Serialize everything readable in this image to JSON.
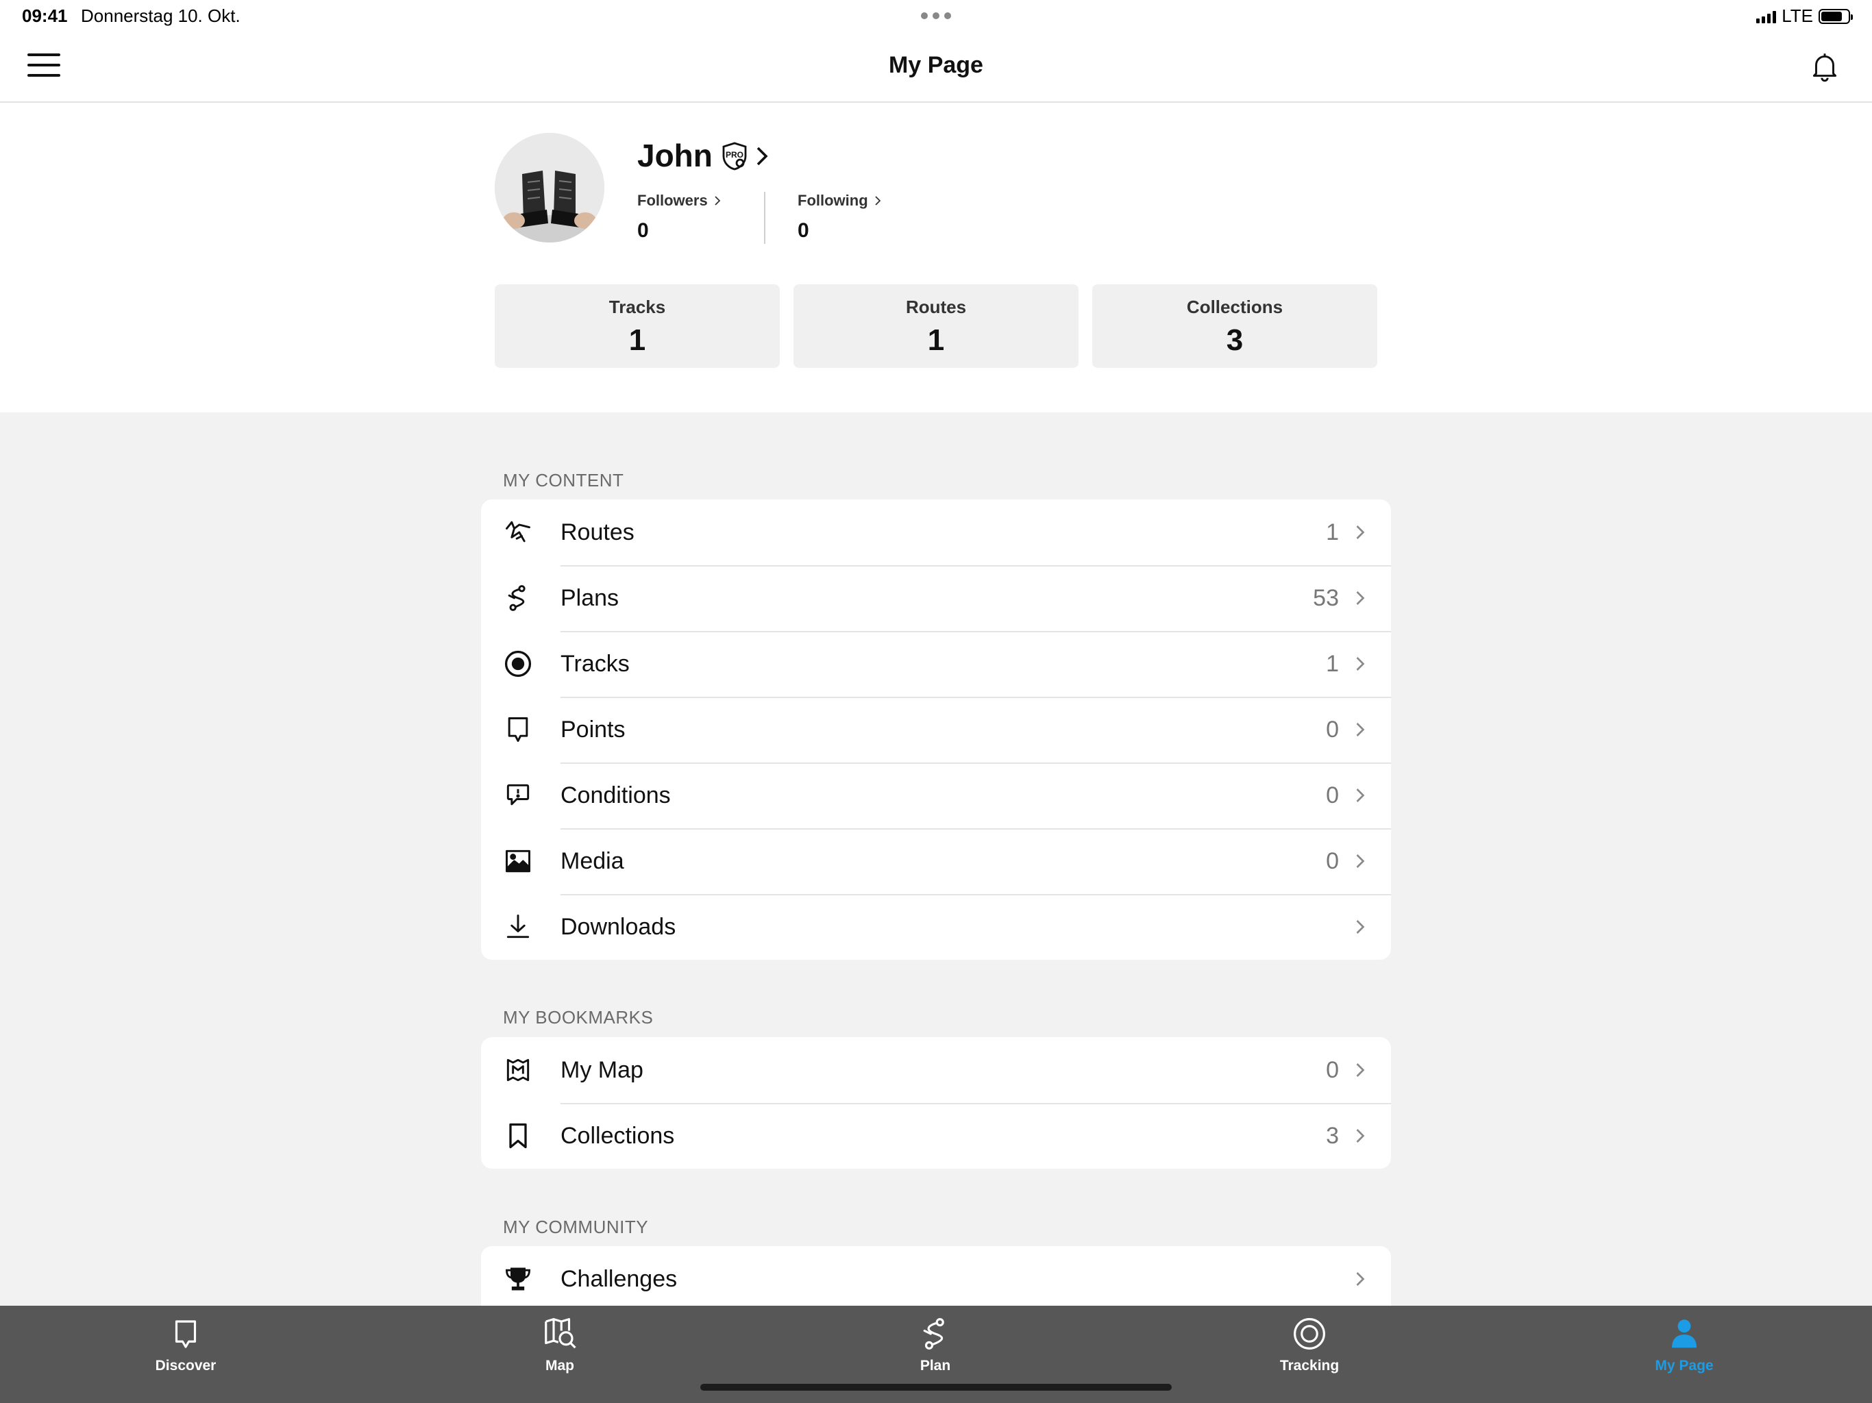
{
  "status_bar": {
    "time": "09:41",
    "date": "Donnerstag 10. Okt.",
    "network": "LTE"
  },
  "nav": {
    "title": "My Page"
  },
  "profile": {
    "name": "John",
    "followers_label": "Followers",
    "followers_count": "0",
    "following_label": "Following",
    "following_count": "0",
    "stats": [
      {
        "label": "Tracks",
        "value": "1"
      },
      {
        "label": "Routes",
        "value": "1"
      },
      {
        "label": "Collections",
        "value": "3"
      }
    ]
  },
  "sections": {
    "my_content": {
      "title": "MY CONTENT",
      "items": [
        {
          "label": "Routes",
          "count": "1",
          "icon": "routes-icon"
        },
        {
          "label": "Plans",
          "count": "53",
          "icon": "plans-icon"
        },
        {
          "label": "Tracks",
          "count": "1",
          "icon": "tracks-icon"
        },
        {
          "label": "Points",
          "count": "0",
          "icon": "points-icon"
        },
        {
          "label": "Conditions",
          "count": "0",
          "icon": "conditions-icon"
        },
        {
          "label": "Media",
          "count": "0",
          "icon": "media-icon"
        },
        {
          "label": "Downloads",
          "count": "",
          "icon": "download-icon"
        }
      ]
    },
    "my_bookmarks": {
      "title": "MY BOOKMARKS",
      "items": [
        {
          "label": "My Map",
          "count": "0",
          "icon": "my-map-icon"
        },
        {
          "label": "Collections",
          "count": "3",
          "icon": "bookmark-icon"
        }
      ]
    },
    "my_community": {
      "title": "MY COMMUNITY",
      "items": [
        {
          "label": "Challenges",
          "count": "",
          "icon": "trophy-icon"
        }
      ]
    }
  },
  "tabbar": {
    "active_color": "#1b9ce4",
    "tabs": [
      {
        "label": "Discover",
        "icon": "discover-icon"
      },
      {
        "label": "Map",
        "icon": "map-search-icon"
      },
      {
        "label": "Plan",
        "icon": "plan-icon"
      },
      {
        "label": "Tracking",
        "icon": "tracking-icon"
      },
      {
        "label": "My Page",
        "icon": "person-icon",
        "active": true
      }
    ]
  }
}
